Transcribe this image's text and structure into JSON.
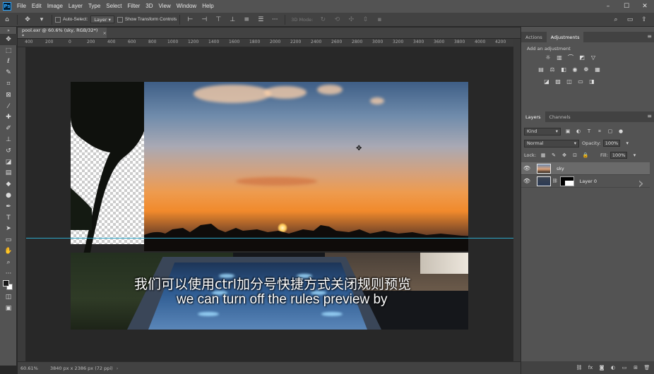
{
  "app": {
    "logo": "Ps",
    "menu": [
      "File",
      "Edit",
      "Image",
      "Layer",
      "Type",
      "Select",
      "Filter",
      "3D",
      "View",
      "Window",
      "Help"
    ],
    "window_controls": [
      "–",
      "☐",
      "✕"
    ]
  },
  "options_bar": {
    "auto_select_label": "Auto-Select:",
    "auto_select_value": "Layer",
    "show_transform_label": "Show Transform Controls",
    "mode_3d_label": "3D Mode:"
  },
  "document": {
    "tab_title": "pool.exr @ 60.6% (sky, RGB/32*) *",
    "close": "×"
  },
  "ruler": {
    "h_labels": [
      "400",
      "200",
      "0",
      "200",
      "400",
      "600",
      "800",
      "1000",
      "1200",
      "1400",
      "1600",
      "1800",
      "2000",
      "2200",
      "2400",
      "2600",
      "2800",
      "3000",
      "3200",
      "3400",
      "3600",
      "3800",
      "4000",
      "4200"
    ]
  },
  "status_bar": {
    "zoom": "60.61%",
    "info": "3840 px x 2386 px (72 ppi)",
    "arrow": "›"
  },
  "subtitles": {
    "chinese": "我们可以使用ctrl加分号快捷方式关闭规则预览",
    "english": "we can turn off the rules preview by"
  },
  "panels": {
    "top_tabs": [
      "Actions",
      "Adjustments"
    ],
    "add_adjustment": "Add an adjustment",
    "layers_tabs": [
      "Layers",
      "Channels"
    ],
    "filter_kind": "Kind",
    "blend_mode": "Normal",
    "opacity_label": "Opacity:",
    "opacity_value": "100%",
    "lock_label": "Lock:",
    "fill_label": "Fill:",
    "fill_value": "100%",
    "layers": [
      {
        "name": "sky",
        "selected": true
      },
      {
        "name": "Layer 0",
        "selected": false
      }
    ]
  },
  "colors": {
    "accent": "#31a8ff",
    "guide": "#2ea7c9",
    "panel_bg": "#535353",
    "canvas_bg": "#282828"
  }
}
